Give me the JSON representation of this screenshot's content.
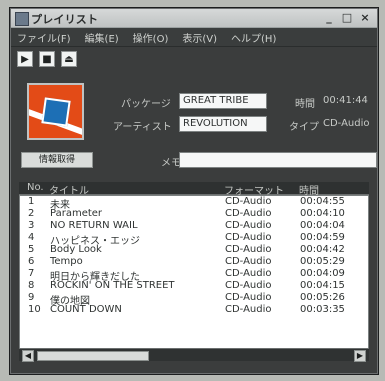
{
  "window": {
    "title": "プレイリスト",
    "controls": {
      "min": "_",
      "max": "□",
      "close": "×"
    }
  },
  "menu": [
    "ファイル(F)",
    "編集(E)",
    "操作(O)",
    "表示(V)",
    "ヘルプ(H)"
  ],
  "toolbar": {
    "icons": [
      "tool-1-icon",
      "tool-2-icon",
      "tool-3-icon"
    ]
  },
  "fields": {
    "package_label": "パッケージ",
    "package_value": "GREAT TRIBE",
    "artist_label": "アーティスト",
    "artist_value": "REVOLUTION",
    "memo_label": "メモ",
    "memo_value": "",
    "time_label": "時間",
    "time_value": "00:41:44",
    "type_label": "タイプ",
    "type_value": "CD-Audio"
  },
  "buttons": {
    "action": "情報取得"
  },
  "list": {
    "columns": [
      "No.",
      "タイトル",
      "フォーマット",
      "時間"
    ],
    "rows": [
      {
        "no": "1",
        "title": "未来",
        "format": "CD-Audio",
        "time": "00:04:55"
      },
      {
        "no": "2",
        "title": "Parameter",
        "format": "CD-Audio",
        "time": "00:04:10"
      },
      {
        "no": "3",
        "title": "NO RETURN WAIL",
        "format": "CD-Audio",
        "time": "00:04:04"
      },
      {
        "no": "4",
        "title": "ハッピネス・エッジ",
        "format": "CD-Audio",
        "time": "00:04:59"
      },
      {
        "no": "5",
        "title": "Body Look",
        "format": "CD-Audio",
        "time": "00:04:42"
      },
      {
        "no": "6",
        "title": "Tempo",
        "format": "CD-Audio",
        "time": "00:05:29"
      },
      {
        "no": "7",
        "title": "明日から輝きだした",
        "format": "CD-Audio",
        "time": "00:04:09"
      },
      {
        "no": "8",
        "title": "ROCKIN' ON THE STREET",
        "format": "CD-Audio",
        "time": "00:04:15"
      },
      {
        "no": "9",
        "title": "僕の地図",
        "format": "CD-Audio",
        "time": "00:05:26"
      },
      {
        "no": "10",
        "title": "COUNT DOWN",
        "format": "CD-Audio",
        "time": "00:03:35"
      }
    ]
  }
}
